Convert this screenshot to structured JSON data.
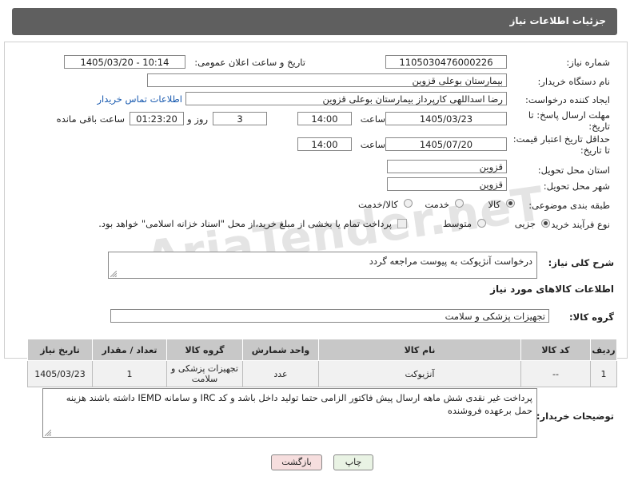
{
  "header": {
    "title": "جزئیات اطلاعات نیاز"
  },
  "form": {
    "need_number": {
      "label": "شماره نیاز:",
      "value": "1105030476000226"
    },
    "announce": {
      "label": "تاریخ و ساعت اعلان عمومی:",
      "value": "1405/03/20 - 10:14"
    },
    "buyer_org": {
      "label": "نام دستگاه خریدار:",
      "value": "بیمارستان بوعلی قزوین"
    },
    "requester": {
      "label": "ایجاد کننده درخواست:",
      "value": "رضا اسداللهی کارپرداز بیمارستان بوعلی قزوین",
      "contact_link": "اطلاعات تماس خریدار"
    },
    "reply_deadline": {
      "label_line1": "مهلت ارسال پاسخ: تا",
      "label_line2": "تاریخ:",
      "date": "1405/03/23",
      "time_label": "ساعت",
      "time": "14:00",
      "days": "3",
      "days_label": "روز و",
      "remaining": "01:23:20",
      "remaining_label": "ساعت باقی مانده"
    },
    "price_deadline": {
      "label_line1": "حداقل تاریخ اعتبار قیمت:",
      "label_line2": "تا تاریخ:",
      "date": "1405/07/20",
      "time_label": "ساعت",
      "time": "14:00"
    },
    "province": {
      "label": "استان محل تحویل:",
      "value": "قزوین"
    },
    "city": {
      "label": "شهر محل تحویل:",
      "value": "قزوین"
    },
    "category": {
      "label": "طبقه بندی موضوعی:",
      "options": [
        "کالا",
        "خدمت",
        "کالا/خدمت"
      ],
      "selected": "کالا"
    },
    "process": {
      "label": "نوع فرآیند خرید :",
      "options": [
        "جزیی",
        "متوسط"
      ],
      "selected": "جزیی",
      "note": "پرداخت تمام یا بخشی از مبلغ خرید،از محل \"اسناد خزانه اسلامی\" خواهد بود."
    },
    "summary": {
      "label": "شرح کلی نیاز:",
      "value": "درخواست آنژیوکت به پیوست مراجعه گردد"
    }
  },
  "goods": {
    "section_title": "اطلاعات کالاهای مورد نیاز",
    "group_label": "گروه کالا:",
    "group_value": "تجهیزات پزشکی و سلامت",
    "columns": [
      "ردیف",
      "کد کالا",
      "نام کالا",
      "واحد شمارش",
      "گروه کالا",
      "تعداد / مقدار",
      "تاریخ نیاز"
    ],
    "rows": [
      {
        "row": "1",
        "code": "--",
        "name": "آنژیوکت",
        "unit": "عدد",
        "group": "تجهیزات پزشکی و سلامت",
        "qty": "1",
        "date": "1405/03/23"
      }
    ]
  },
  "buyer_notes": {
    "label": "توضیحات خریدار:",
    "value": "پرداخت غیر نقدی شش ماهه ارسال پیش فاکتور الزامی حتما تولید داخل باشد و کد IRC و سامانه IEMD داشته باشند هزینه حمل برعهده فروشنده"
  },
  "buttons": {
    "print": "چاپ",
    "back": "بازگشت"
  },
  "watermark": "AriaTender.neT"
}
